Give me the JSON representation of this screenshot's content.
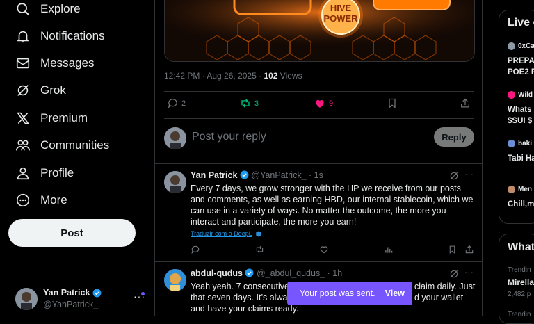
{
  "nav": {
    "items": [
      {
        "label": "Explore",
        "icon": "search-icon"
      },
      {
        "label": "Notifications",
        "icon": "bell-icon"
      },
      {
        "label": "Messages",
        "icon": "envelope-icon"
      },
      {
        "label": "Grok",
        "icon": "grok-icon"
      },
      {
        "label": "Premium",
        "icon": "x-logo-icon"
      },
      {
        "label": "Communities",
        "icon": "people-icon"
      },
      {
        "label": "Profile",
        "icon": "person-icon"
      },
      {
        "label": "More",
        "icon": "more-circle-icon"
      }
    ],
    "post_label": "Post",
    "account": {
      "name": "Yan Patrick",
      "handle": "@YanPatrick_"
    }
  },
  "main": {
    "media": {
      "badge_line1": "HIVE",
      "badge_line2": "POWER"
    },
    "meta": {
      "time": "12:42 PM · Aug 26, 2025 · ",
      "views_count": "102",
      "views_label": " Views"
    },
    "actions": {
      "replies": "2",
      "reposts": "3",
      "likes": "9"
    },
    "reply": {
      "placeholder": "Post your reply",
      "button": "Reply"
    },
    "tweets": [
      {
        "name": "Yan Patrick",
        "handle": "@YanPatrick_",
        "time": "· 1s",
        "text": "Every 7 days, we grow stronger with the HP we receive from our posts and comments, as well as earning HBD, our internal stablecoin, which we can use in a variety of ways. No matter the outcome, the more you interact and participate, the more you earn!",
        "translate": "Traduzir com o DeepL"
      },
      {
        "name": "abdul-qudus",
        "handle": "@_abdul_qudus_",
        "time": "· 1h",
        "text_line1": "Yeah yeah. 7 consecutive d",
        "text_line1b": "claim daily. Just",
        "text_line2": "that seven days. It’s alway",
        "text_line2b": "d your wallet",
        "text_line3": "and have your claims ready."
      }
    ],
    "toast": {
      "text": "Your post was sent.",
      "action": "View"
    }
  },
  "right": {
    "live_title": "Live o",
    "live_items": [
      {
        "user": "0xCa",
        "text1": "PREPA",
        "text2": "POE2 F",
        "color": "#8b98a5"
      },
      {
        "user": "Wild",
        "text1": "Whats",
        "text2": "$SUI $",
        "color": "#f91880"
      },
      {
        "user": "baki",
        "text1": "Tabi Ha",
        "text2": "",
        "color": "#6b8fd6"
      },
      {
        "user": "Men",
        "text1": "Chill,m",
        "text2": "",
        "color": "#c08a6a"
      }
    ],
    "whats_title": "What",
    "trend": {
      "label": "Trendin",
      "title": "Mirella",
      "posts": "2,482 p"
    },
    "trend2_label": "Trendin"
  },
  "colors": {
    "accent": "#1d9bf0",
    "repost": "#00ba7c",
    "like": "#f91880",
    "toast": "#7856ff"
  }
}
